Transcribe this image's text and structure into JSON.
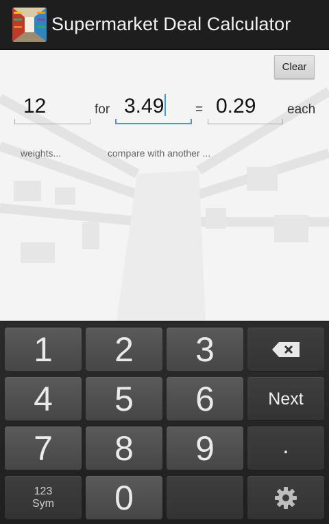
{
  "app": {
    "title": "Supermarket Deal Calculator"
  },
  "toolbar": {
    "clear_label": "Clear"
  },
  "calc": {
    "quantity": "12",
    "for_label": "for",
    "price": "3.49",
    "equals_label": "=",
    "unit_price": "0.29",
    "each_label": "each",
    "weights_hint": "weights...",
    "compare_hint": "compare with another ..."
  },
  "keyboard": {
    "keys": [
      "1",
      "2",
      "3",
      "4",
      "5",
      "6",
      "7",
      "8",
      "9",
      "0"
    ],
    "next_label": "Next",
    "dot_label": ".",
    "symbols_line1": "123",
    "symbols_line2": "Sym",
    "icons": [
      "backspace-icon",
      "settings-gear-icon"
    ]
  },
  "colors": {
    "accent": "#33a3d3",
    "action_bar": "#1e1e1e",
    "keyboard_bg": "#262626"
  }
}
